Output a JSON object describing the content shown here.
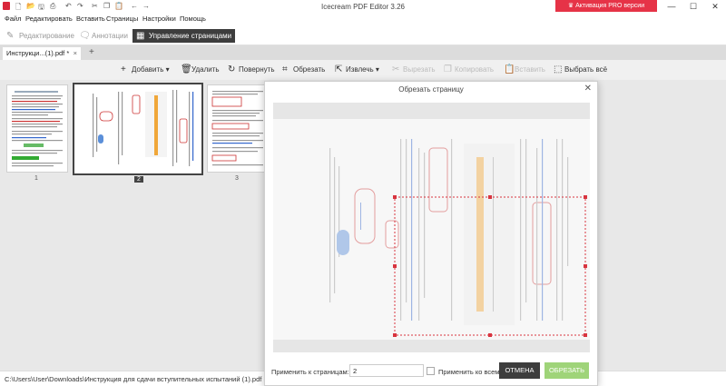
{
  "app": {
    "title": "Icecream PDF Editor 3.26",
    "promo_label": "Активация PRO версии",
    "quick_access": [
      "new-icon",
      "open-icon",
      "save-icon",
      "print-icon",
      "undo-icon",
      "redo-icon",
      "cut-icon",
      "copy-icon",
      "paste-icon",
      "back-icon",
      "forward-icon"
    ],
    "window_controls": {
      "minimize": "—",
      "maximize": "☐",
      "close": "✕"
    }
  },
  "menu": [
    "Файл",
    "Редактировать",
    "Вставить",
    "Страницы",
    "Настройки",
    "Помощь"
  ],
  "modes": [
    {
      "label": "Редактирование",
      "icon": "pencil-icon",
      "active": false
    },
    {
      "label": "Аннотации",
      "icon": "comment-icon",
      "active": false
    },
    {
      "label": "Управление страницами",
      "icon": "pages-icon",
      "active": true
    }
  ],
  "tabs": [
    {
      "label": "Инструкци...(1).pdf *",
      "close": "×"
    }
  ],
  "tab_add": "+",
  "toolbar": [
    {
      "label": "Добавить",
      "icon": "plus-icon",
      "dropdown": true,
      "enabled": true
    },
    {
      "label": "Удалить",
      "icon": "trash-icon",
      "enabled": true
    },
    {
      "label": "Повернуть",
      "icon": "rotate-icon",
      "enabled": true
    },
    {
      "label": "Обрезать",
      "icon": "crop-icon",
      "enabled": true
    },
    {
      "label": "Извлечь",
      "icon": "extract-icon",
      "dropdown": true,
      "enabled": true
    },
    {
      "label": "Вырезать",
      "icon": "cut-icon",
      "enabled": false
    },
    {
      "label": "Копировать",
      "icon": "copy-icon",
      "enabled": false
    },
    {
      "label": "Вставить",
      "icon": "paste-icon",
      "enabled": false
    },
    {
      "label": "Выбрать всё",
      "icon": "select-all-icon",
      "enabled": true
    }
  ],
  "thumbnails": [
    {
      "number": "1",
      "selected": false
    },
    {
      "number": "2",
      "selected": true
    },
    {
      "number": "3",
      "selected": false
    }
  ],
  "dialog": {
    "title": "Обрезать страницу",
    "apply_label": "Применить к страницам:",
    "pages_value": "2",
    "apply_all_label": "Применить ко всем",
    "apply_all_checked": false,
    "cancel_label": "ОТМЕНА",
    "crop_label": "ОБРЕЗАТЬ"
  },
  "status": {
    "path": "C:\\Users\\User\\Downloads\\Инструкция для сдачи вступительных испытаний (1).pdf"
  },
  "colors": {
    "accent": "#e63347",
    "dark": "#3d3d3d",
    "crop_green": "#9fd479",
    "crop_line": "#d8343f"
  }
}
